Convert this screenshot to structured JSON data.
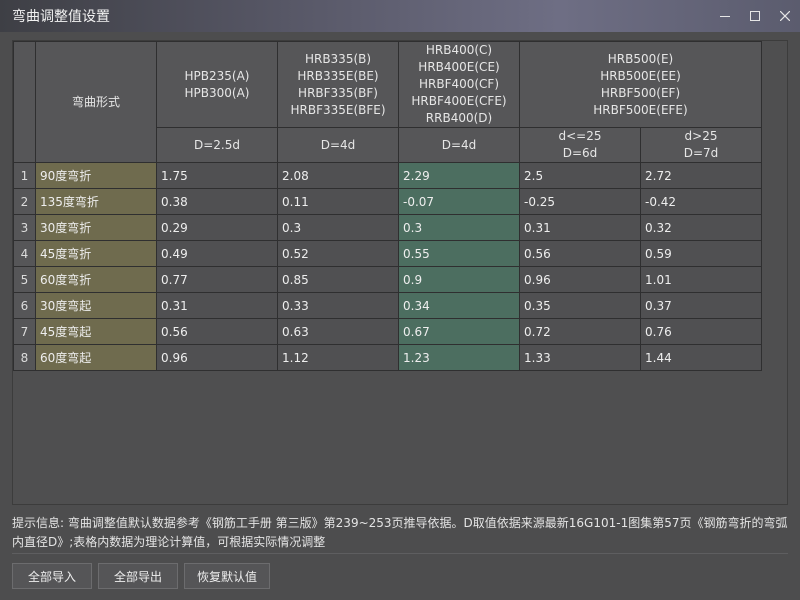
{
  "window": {
    "title": "弯曲调整值设置",
    "minimize_icon": "minimize-icon",
    "maximize_icon": "maximize-icon",
    "close_icon": "close-icon"
  },
  "table": {
    "corner_label": "弯曲形式",
    "groups": [
      {
        "lines": [
          "HPB235(A)",
          "HPB300(A)"
        ],
        "subs": [
          "D=2.5d"
        ]
      },
      {
        "lines": [
          "HRB335(B)",
          "HRB335E(BE)",
          "HRBF335(BF)",
          "HRBF335E(BFE)"
        ],
        "subs": [
          "D=4d"
        ]
      },
      {
        "lines": [
          "HRB400(C)",
          "HRB400E(CE)",
          "HRBF400(CF)",
          "HRBF400E(CFE)",
          "RRB400(D)"
        ],
        "subs": [
          "D=4d"
        ]
      },
      {
        "lines": [
          "HRB500(E)",
          "HRB500E(EE)",
          "HRBF500(EF)",
          "HRBF500E(EFE)"
        ],
        "subs": [
          "d<=25\nD=6d",
          "d>25\nD=7d"
        ]
      }
    ],
    "rows": [
      {
        "num": "1",
        "name": "90度弯折",
        "values": [
          "1.75",
          "2.08",
          "2.29",
          "2.5",
          "2.72"
        ]
      },
      {
        "num": "2",
        "name": "135度弯折",
        "values": [
          "0.38",
          "0.11",
          "-0.07",
          "-0.25",
          "-0.42"
        ]
      },
      {
        "num": "3",
        "name": "30度弯折",
        "values": [
          "0.29",
          "0.3",
          "0.3",
          "0.31",
          "0.32"
        ]
      },
      {
        "num": "4",
        "name": "45度弯折",
        "values": [
          "0.49",
          "0.52",
          "0.55",
          "0.56",
          "0.59"
        ]
      },
      {
        "num": "5",
        "name": "60度弯折",
        "values": [
          "0.77",
          "0.85",
          "0.9",
          "0.96",
          "1.01"
        ]
      },
      {
        "num": "6",
        "name": "30度弯起",
        "values": [
          "0.31",
          "0.33",
          "0.34",
          "0.35",
          "0.37"
        ]
      },
      {
        "num": "7",
        "name": "45度弯起",
        "values": [
          "0.56",
          "0.63",
          "0.67",
          "0.72",
          "0.76"
        ]
      },
      {
        "num": "8",
        "name": "60度弯起",
        "values": [
          "0.96",
          "1.12",
          "1.23",
          "1.33",
          "1.44"
        ]
      }
    ],
    "colors": {
      "name_cell": "#6f6b4e",
      "highlight_column": "#4c6e60"
    }
  },
  "hint": "提示信息: 弯曲调整值默认数据参考《钢筋工手册 第三版》第239~253页推导依据。D取值依据来源最新16G101-1图集第57页《钢筋弯折的弯弧内直径D》;表格内数据为理论计算值，可根据实际情况调整",
  "buttons": {
    "import_all": "全部导入",
    "export_all": "全部导出",
    "restore_default": "恢复默认值"
  }
}
